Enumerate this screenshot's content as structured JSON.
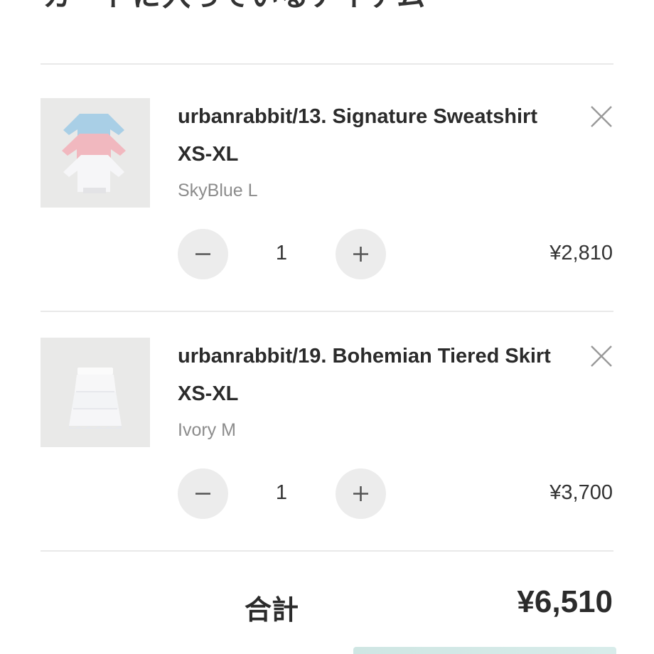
{
  "page": {
    "heading_partial": "カートに入っているアイテム"
  },
  "cart": {
    "items": [
      {
        "title": "urbanrabbit/13. Signature Sweatshirt XS-XL",
        "variant": "SkyBlue L",
        "quantity": "1",
        "price": "¥2,810",
        "decrement_symbol": "−",
        "increment_symbol": "+",
        "remove_icon": "close-icon",
        "thumbnail": "stacked sweatshirts in sky blue, pink and white"
      },
      {
        "title": "urbanrabbit/19. Bohemian Tiered Skirt XS-XL",
        "variant": "Ivory M",
        "quantity": "1",
        "price": "¥3,700",
        "decrement_symbol": "−",
        "increment_symbol": "+",
        "remove_icon": "close-icon",
        "thumbnail": "white tiered skirt"
      }
    ],
    "total_label": "合計",
    "total_value": "¥6,510"
  },
  "colors": {
    "background": "#ffffff",
    "divider": "#e9e9e9",
    "button_bg": "#ececec",
    "text_primary": "#2b2b2b",
    "text_secondary": "#8c8c8c"
  }
}
